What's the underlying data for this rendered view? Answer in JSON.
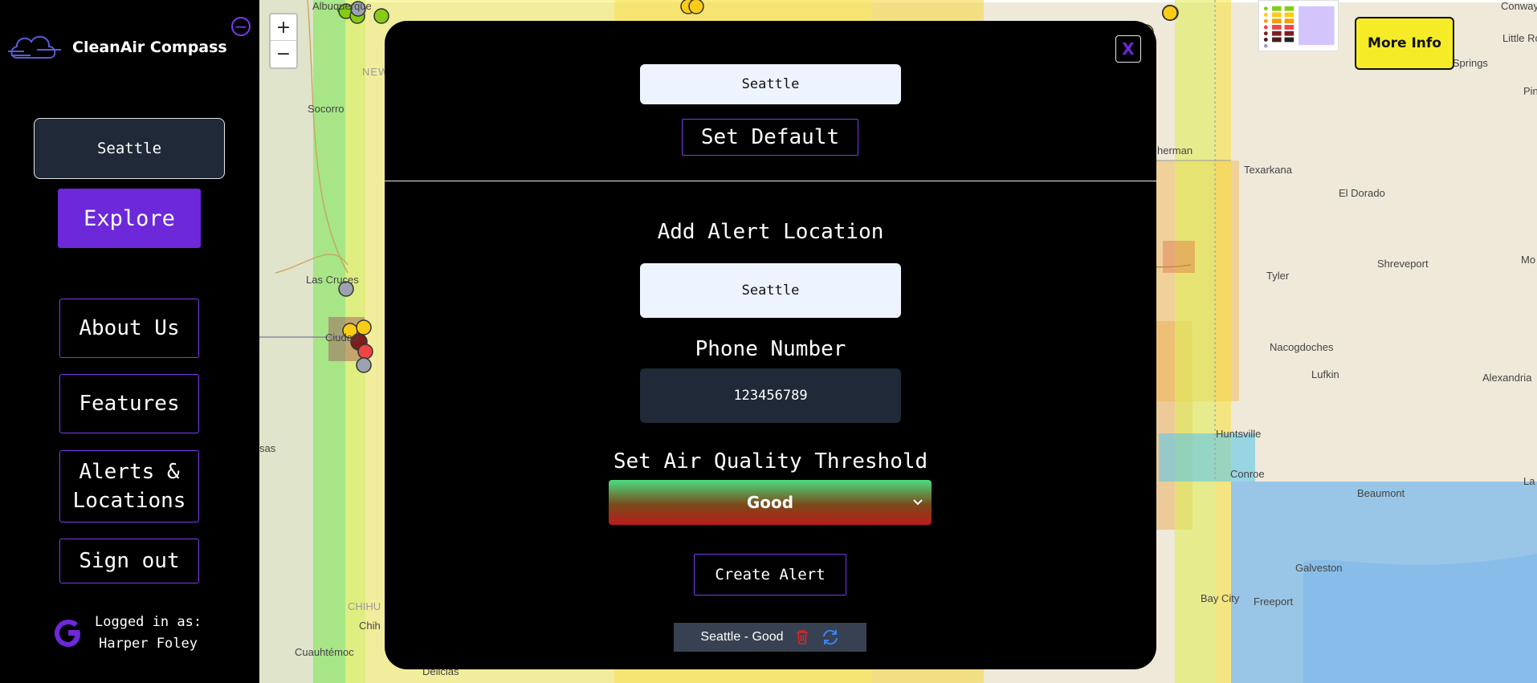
{
  "sidebar": {
    "brand_name": "CleanAir Compass",
    "location_value": "Seattle",
    "explore_label": "Explore",
    "nav": {
      "about": "About Us",
      "features": "Features",
      "alerts": "Alerts & Locations",
      "signout": "Sign out"
    },
    "user": {
      "logged_in_label": "Logged in as:",
      "name": "Harper Foley"
    }
  },
  "map": {
    "zoom_in": "+",
    "zoom_out": "−",
    "more_info_label": "More Info",
    "labels": {
      "albuquerque": "Albuquerque",
      "socorro": "Socorro",
      "new_mexico": "NEW",
      "las_cruces": "Las Cruces",
      "ciudad": "Ciudad",
      "chihuahua": "CHIHU",
      "chih": "Chih",
      "cuauhtemoc": "Cuauhtémoc",
      "delicias": "Delicias",
      "sas": "sas",
      "sherman": "herman",
      "texarkana": "Texarkana",
      "el_dorado": "El Dorado",
      "tyler": "Tyler",
      "shreveport": "Shreveport",
      "nacogdoches": "Nacogdoches",
      "lufkin": "Lufkin",
      "huntsville": "Huntsville",
      "conroe": "Conroe",
      "beaumont": "Beaumont",
      "galveston": "Galveston",
      "bay_city": "Bay City",
      "freeport": "Freeport",
      "hot_springs": "Hot Springs",
      "little_rock": "Little Ro",
      "conway": "Conway",
      "alexandria": "Alexandria",
      "la": "La",
      "mo": "Mo",
      "pin": "Pin"
    },
    "colors": {
      "good": "#84cc16",
      "moderate": "#facc15",
      "usg": "#f59e0b",
      "unhealthy": "#ef4444",
      "very_unhealthy": "#7f1d1d",
      "no_data": "#9ca3af"
    }
  },
  "modal": {
    "close_label": "X",
    "default_location": "Seattle",
    "set_default_label": "Set Default",
    "add_alert_heading": "Add Alert Location",
    "alert_location": "Seattle",
    "phone_heading": "Phone Number",
    "phone_value": "123456789",
    "threshold_heading": "Set Air Quality Threshold",
    "threshold_value": "Good",
    "create_alert_label": "Create Alert",
    "alerts": [
      {
        "label": "Seattle - Good"
      }
    ]
  }
}
